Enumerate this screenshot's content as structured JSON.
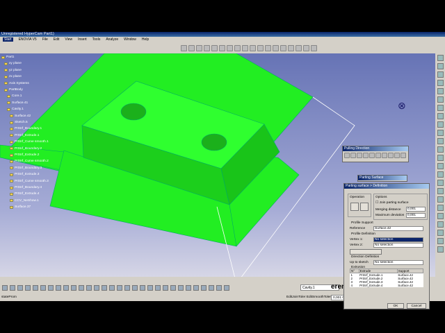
{
  "window": {
    "title": "Unregistered HyperCam Part1)"
  },
  "menu": [
    "Start",
    "ENOVIA V5",
    "File",
    "Edit",
    "View",
    "Insert",
    "Tools",
    "Analyze",
    "Window",
    "Help"
  ],
  "tree": [
    "Part1",
    "xy plane",
    "yz plane",
    "zx plane",
    "Axis Systems",
    "PartBody",
    "Core.1",
    "Surface.41",
    "Cavity.1",
    "Surface.42",
    "Sketch.5",
    "PrtSrf_Boundary.1",
    "PrtSrf_Extrude.1",
    "PrtSrf_Curve smooth.1",
    "PrtSrf_Boundary.2",
    "PrtSrf_Extrude.2",
    "PrtSrf_Curve smooth.2",
    "PrtSrf_Boundary.3",
    "PrtSrf_Extrude.3",
    "PrtSrf_Curve smooth.3",
    "PrtSrf_Boundary.4",
    "PrtSrf_Extrude.4",
    "CCV_NeShow.1",
    "Surface.37"
  ],
  "pulling": {
    "title": "Pulling Direction"
  },
  "parting": {
    "title": "Parting Surface"
  },
  "dialog": {
    "title": "Parting surface > Definition",
    "operation_label": "Operation",
    "options_label": "Options",
    "join_label": "Join parting surface",
    "merging_label": "Merging distance",
    "merging_value": "0,001",
    "maxdev_label": "Maximum deviation",
    "maxdev_value": "0,001",
    "profile_support_label": "Profile Support",
    "reference_label": "Reference",
    "reference_value": "Surface.42",
    "profile_def_label": "Profile Definition",
    "vertex1_label": "Vertex 1:",
    "vertex1_value": "No selection",
    "vertex2_label": "Vertex 2:",
    "vertex2_value": "No selection",
    "direction_label": "Direction Definition",
    "up_to_sketch_label": "Up to sketch",
    "up_to_sketch_value": "No selection",
    "extrusion_label": "Extrusion",
    "columns": [
      "N°",
      "Extrude",
      "Support"
    ],
    "rows": [
      [
        "1",
        "PrtSrf_Extrude.1",
        "Surface.42"
      ],
      [
        "2",
        "PrtSrf_Extrude.2",
        "Surface.42"
      ],
      [
        "3",
        "PrtSrf_Extrude.3",
        "Surface.42"
      ],
      [
        "4",
        "PrtSrf_Extrude.4",
        "Surface.42"
      ]
    ],
    "ok_label": "OK",
    "cancel_label": "Cancel"
  },
  "bottom": {
    "input_value": "Cavity.1"
  },
  "status": {
    "left": "stateProm",
    "right": "EditJoinToler EditSmoothToler",
    "field": "0,001 0,001"
  },
  "watermark": "erentuncay@gmail.com",
  "colors": {
    "surface": "#22ee22",
    "viewport_top": "#6673b5"
  }
}
